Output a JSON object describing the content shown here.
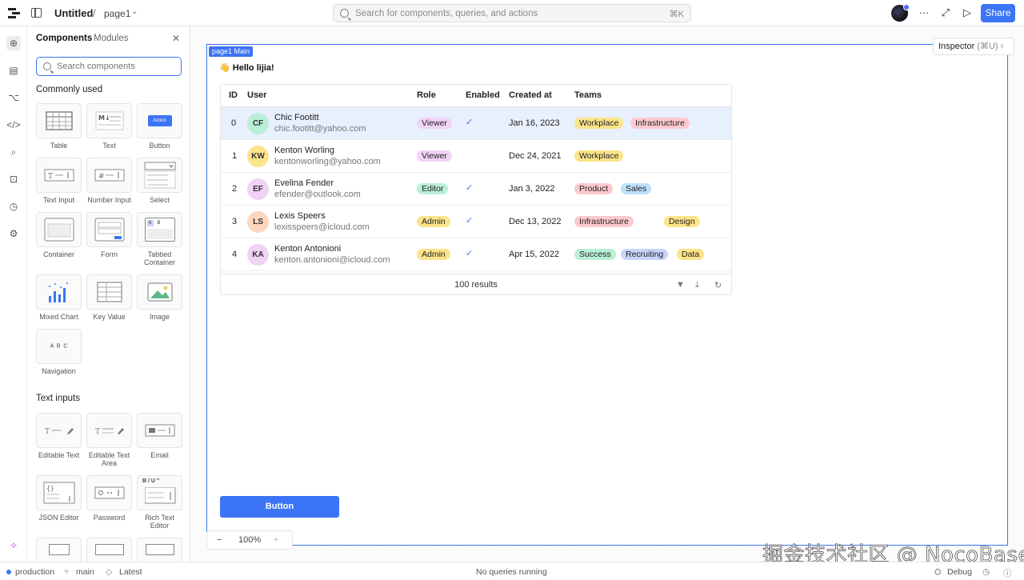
{
  "topbar": {
    "app_name": "Untitled",
    "separator": "/",
    "page_name": "page1",
    "search_placeholder": "Search for components, queries, and actions",
    "search_shortcut": "⌘K",
    "more": "···",
    "expand": "⤢",
    "preview": "▷",
    "share_label": "Share"
  },
  "panel": {
    "tab_components": "Components",
    "tab_modules": "Modules",
    "close": "✕",
    "search_placeholder": "Search components",
    "section_common": "Commonly used",
    "section_text": "Text inputs",
    "common": [
      {
        "label": "Table"
      },
      {
        "label": "Text"
      },
      {
        "label": "Button",
        "glyph": "Action"
      },
      {
        "label": "Text Input"
      },
      {
        "label": "Number Input"
      },
      {
        "label": "Select"
      },
      {
        "label": "Container"
      },
      {
        "label": "Form"
      },
      {
        "label": "Tabbed Container",
        "glyph_a": "A",
        "glyph_b": "B"
      },
      {
        "label": "Mixed Chart"
      },
      {
        "label": "Key Value"
      },
      {
        "label": "Image"
      },
      {
        "label": "Navigation",
        "glyph": "A  B  C"
      }
    ],
    "text_inputs": [
      {
        "label": "Editable Text"
      },
      {
        "label": "Editable Text Area"
      },
      {
        "label": "Email"
      },
      {
        "label": "JSON Editor"
      },
      {
        "label": "Password"
      },
      {
        "label": "Rich Text Editor",
        "glyph": "B / U \""
      }
    ]
  },
  "canvas": {
    "frame_tag": "page1 Main",
    "inspector_label": "Inspector",
    "inspector_shortcut": "(⌘U)",
    "greeting": "👋 Hello lijia!",
    "button_label": "Button",
    "zoom_minus": "−",
    "zoom_value": "100%",
    "zoom_plus": "+"
  },
  "table": {
    "columns": [
      "ID",
      "User",
      "Role",
      "Enabled",
      "Created at",
      "Teams"
    ],
    "rows": [
      {
        "id": "0",
        "initials": "CF",
        "name": "Chic Footitt",
        "email": "chic.footitt@yahoo.com",
        "role": "Viewer",
        "enabled": true,
        "created": "Jan 16, 2023",
        "teams": [
          "Workplace",
          "Infrastructure"
        ]
      },
      {
        "id": "1",
        "initials": "KW",
        "name": "Kenton Worling",
        "email": "kentonworling@yahoo.com",
        "role": "Viewer",
        "enabled": false,
        "created": "Dec 24, 2021",
        "teams": [
          "Workplace"
        ]
      },
      {
        "id": "2",
        "initials": "EF",
        "name": "Evelina Fender",
        "email": "efender@outlook.com",
        "role": "Editor",
        "enabled": true,
        "created": "Jan 3, 2022",
        "teams": [
          "Product",
          "Sales"
        ]
      },
      {
        "id": "3",
        "initials": "LS",
        "name": "Lexis Speers",
        "email": "lexisspeers@icloud.com",
        "role": "Admin",
        "enabled": true,
        "created": "Dec 13, 2022",
        "teams": [
          "Infrastructure",
          "Design"
        ]
      },
      {
        "id": "4",
        "initials": "KA",
        "name": "Kenton Antonioni",
        "email": "kenton.antonioni@icloud.com",
        "role": "Admin",
        "enabled": true,
        "created": "Apr 15, 2022",
        "teams": [
          "Success",
          "Recruiting",
          "Data"
        ]
      }
    ],
    "check_mark": "✓",
    "results": "100 results"
  },
  "colors": {
    "accent": "#3b74f5",
    "role_viewer": "#f0d3f5",
    "role_editor": "#b9efd6",
    "role_admin": "#fbe48a",
    "team_workplace": "#fbe48a",
    "team_infrastructure": "#fcc9cf",
    "team_product": "#fcc9cf",
    "team_sales": "#bfe0fb",
    "team_design": "#fbe48a",
    "team_success": "#b9efd6",
    "team_recruiting": "#c9d4fb",
    "team_data": "#fbe48a"
  },
  "watermark": "掘金技术社区 @ NocoBase",
  "statusbar": {
    "env": "production",
    "branch": "main",
    "version": "Latest",
    "queries": "No queries running",
    "debug": "Debug"
  }
}
